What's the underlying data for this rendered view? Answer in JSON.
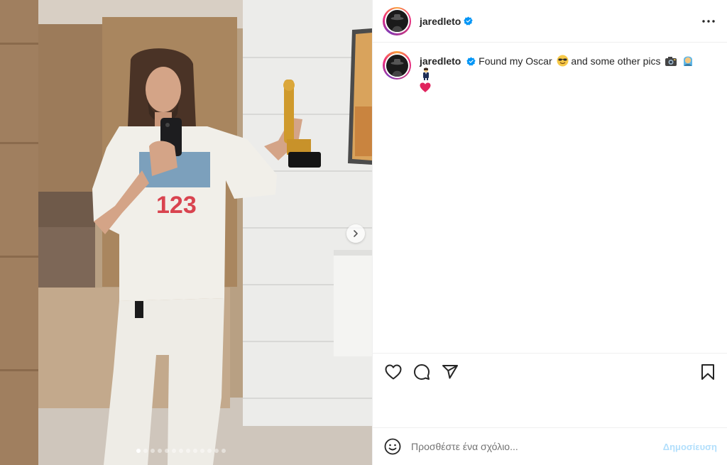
{
  "post": {
    "author": {
      "username": "jaredleto",
      "verified": true
    },
    "caption": {
      "username": "jaredleto",
      "text": "Found my Oscar",
      "text_after_emoji": "and some other pics",
      "emojis": [
        "smiling-face-with-sunglasses",
        "camera-with-flash",
        "woman-with-veil-face",
        "woman-in-tuxedo",
        "red-heart"
      ]
    },
    "carousel": {
      "total_slides": 13,
      "current_slide": 1
    }
  },
  "comment": {
    "placeholder": "Προσθέστε ένα σχόλιο...",
    "publish_label": "Δημοσίευση"
  },
  "colors": {
    "verified_blue": "#0095f6",
    "publish_disabled": "#b2dffc",
    "heart_red": "#e0245e"
  }
}
